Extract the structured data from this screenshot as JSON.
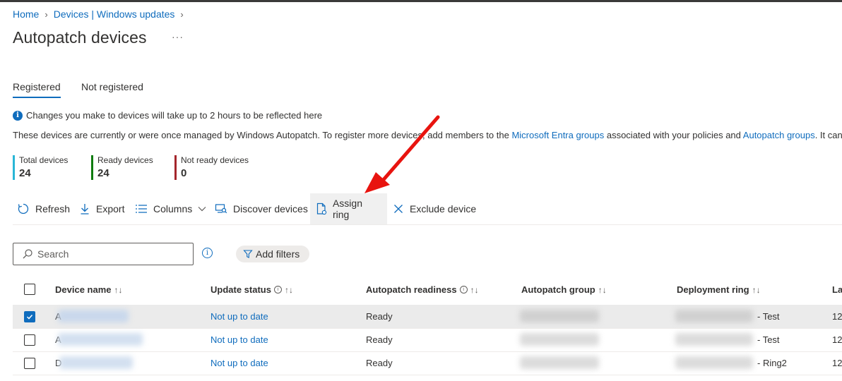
{
  "breadcrumb": {
    "home": "Home",
    "devices": "Devices | Windows updates"
  },
  "page": {
    "title": "Autopatch devices",
    "more": "···"
  },
  "tabs": [
    {
      "label": "Registered"
    },
    {
      "label": "Not registered"
    }
  ],
  "info": {
    "icon": "info-icon",
    "text": "Changes you make to devices will take up to 2 hours to be reflected here"
  },
  "description": {
    "part1": "These devices are currently or were once managed by Windows Autopatch. To register more devices, add members to the ",
    "link1": "Microsoft Entra groups",
    "part2": " associated with your policies and ",
    "link2": "Autopatch groups",
    "part3": ". It can t"
  },
  "stats": [
    {
      "label": "Total devices",
      "value": "24",
      "color": "#29b6d6"
    },
    {
      "label": "Ready devices",
      "value": "24",
      "color": "#107c10"
    },
    {
      "label": "Not ready devices",
      "value": "0",
      "color": "#a4262c"
    }
  ],
  "toolbar": {
    "refresh": "Refresh",
    "export": "Export",
    "columns": "Columns",
    "discover": "Discover devices",
    "assign_ring": "Assign ring",
    "exclude": "Exclude device"
  },
  "search": {
    "placeholder": "Search"
  },
  "filters": {
    "add": "Add filters"
  },
  "table": {
    "headers": {
      "device_name": "Device name",
      "update_status": "Update status",
      "readiness": "Autopatch readiness",
      "group": "Autopatch group",
      "ring": "Deployment ring",
      "last": "La"
    },
    "rows": [
      {
        "selected": true,
        "name_initial": "A",
        "update_status": "Not up to date",
        "readiness": "Ready",
        "ring_suffix": "- Test",
        "last": "12"
      },
      {
        "selected": false,
        "name_initial": "A",
        "update_status": "Not up to date",
        "readiness": "Ready",
        "ring_suffix": "- Test",
        "last": "12"
      },
      {
        "selected": false,
        "name_initial": "D",
        "update_status": "Not up to date",
        "readiness": "Ready",
        "ring_suffix": "- Ring2",
        "last": "12"
      }
    ]
  },
  "colors": {
    "accent": "#0f6cbd",
    "annotation_arrow": "#e8140f"
  }
}
